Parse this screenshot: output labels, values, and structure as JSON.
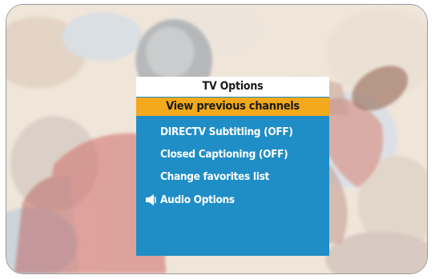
{
  "menu": {
    "title": "TV Options",
    "items": [
      {
        "label": "View previous channels",
        "selected": true
      },
      {
        "label": "DIRECTV Subtitling (OFF)",
        "selected": false
      },
      {
        "label": "Closed Captioning (OFF)",
        "selected": false
      },
      {
        "label": "Change favorites list",
        "selected": false
      },
      {
        "label": "Audio Options",
        "selected": false,
        "icon": "speaker-icon"
      }
    ]
  },
  "colors": {
    "menu_background": "#1f8dc6",
    "highlight": "#f2a91c",
    "title_background": "#ffffff"
  }
}
